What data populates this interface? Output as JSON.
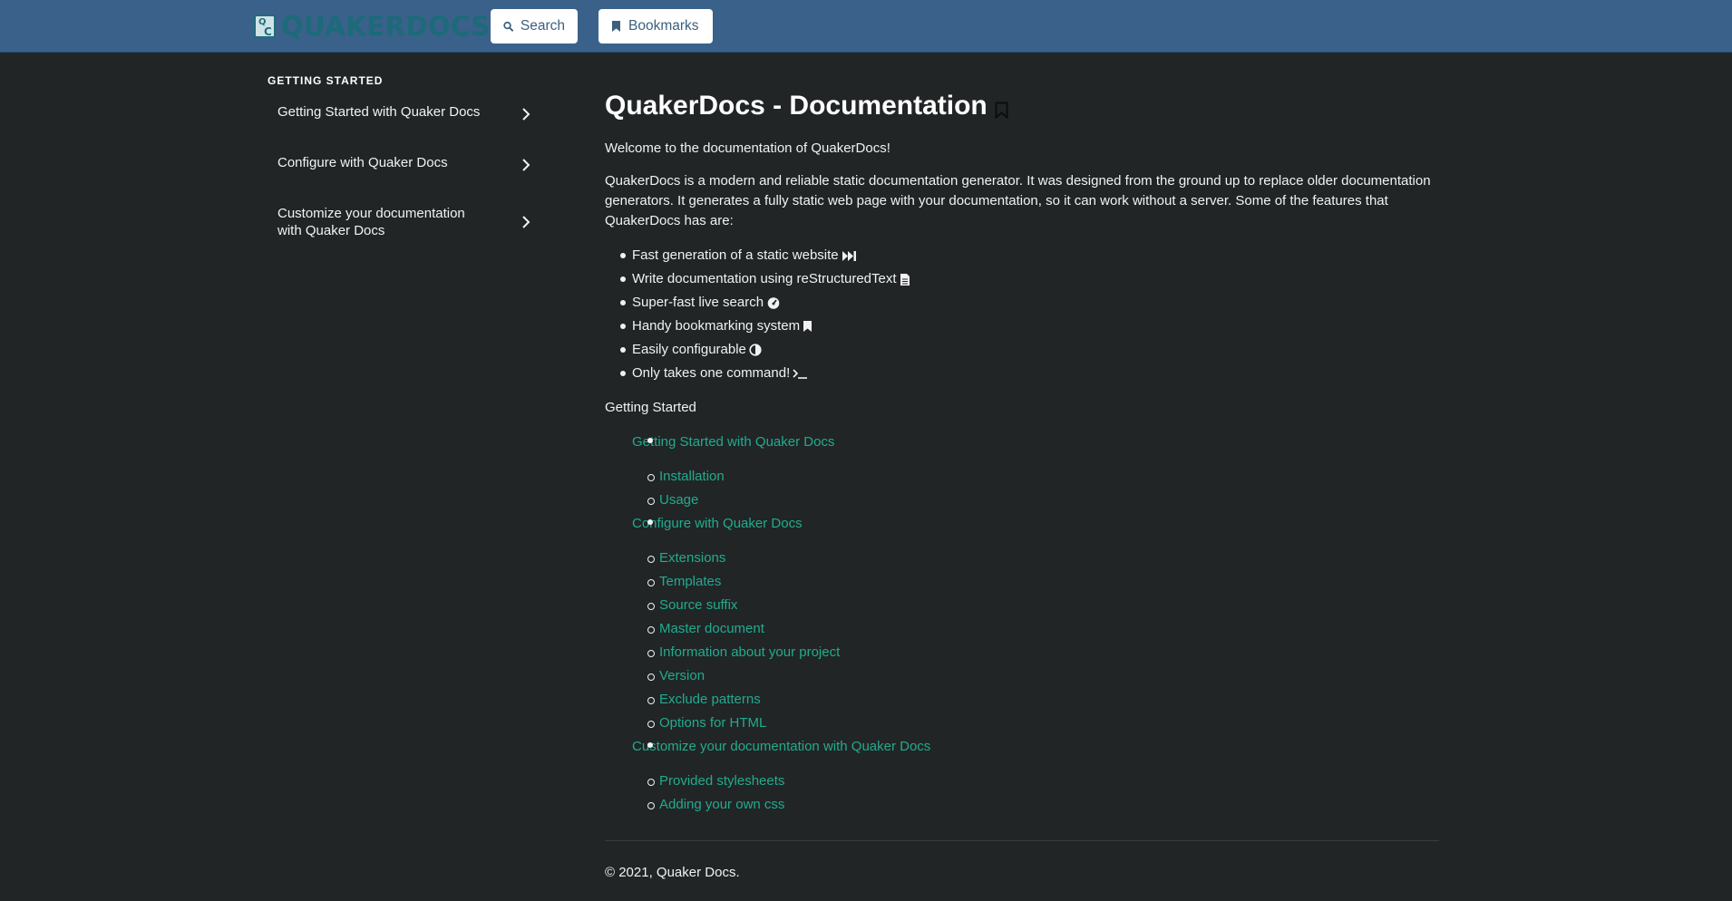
{
  "topbar": {
    "logo_text": "QUAKERDOCS",
    "logo_mark": "QC",
    "search_label": "Search",
    "bookmarks_label": "Bookmarks"
  },
  "sidebar": {
    "heading": "GETTING STARTED",
    "items": [
      {
        "label": "Getting Started with Quaker Docs"
      },
      {
        "label": "Configure with Quaker Docs"
      },
      {
        "label": "Customize your documentation with Quaker Docs"
      }
    ]
  },
  "main": {
    "title": "QuakerDocs - Documentation",
    "welcome": "Welcome to the documentation of QuakerDocs!",
    "intro": "QuakerDocs is a modern and reliable static documentation generator. It was designed from the ground up to replace older documentation generators. It generates a fully static web page with your documentation, so it can work without a server. Some of the features that QuakerDocs has are:",
    "features": [
      {
        "text": "Fast generation of a static website",
        "icon": "fast-forward-icon"
      },
      {
        "text": "Write documentation using reStructuredText",
        "icon": "document-icon"
      },
      {
        "text": "Super-fast live search",
        "icon": "speedometer-icon"
      },
      {
        "text": "Handy bookmarking system",
        "icon": "bookmark-icon"
      },
      {
        "text": "Easily configurable",
        "icon": "contrast-icon"
      },
      {
        "text": "Only takes one command!",
        "icon": "terminal-icon"
      }
    ],
    "toc_title": "Getting Started",
    "toc": [
      {
        "label": "Getting Started with Quaker Docs",
        "children": [
          "Installation",
          "Usage"
        ]
      },
      {
        "label": "Configure with Quaker Docs",
        "children": [
          "Extensions",
          "Templates",
          "Source suffix",
          "Master document",
          "Information about your project",
          "Version",
          "Exclude patterns",
          "Options for HTML"
        ]
      },
      {
        "label": "Customize your documentation with Quaker Docs",
        "children": [
          "Provided stylesheets",
          "Adding your own css"
        ]
      }
    ],
    "footer": "© 2021, Quaker Docs."
  },
  "colors": {
    "topbar": "#3a6189",
    "background": "#212526",
    "link": "#22ab8f",
    "logo": "#1c6a7a"
  }
}
